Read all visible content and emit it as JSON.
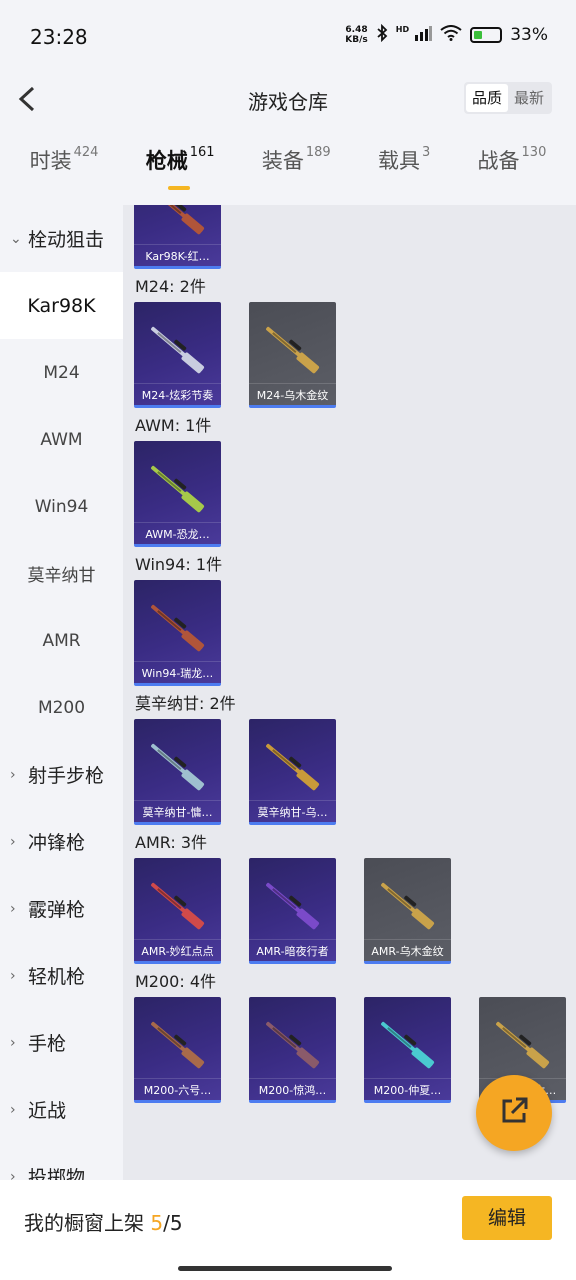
{
  "status_bar": {
    "time": "23:28",
    "net_speed_value": "6.48",
    "net_speed_unit": "KB/s",
    "signal_label": "HD",
    "battery_percent": "33%",
    "battery_level": 0.33,
    "icons": [
      "bluetooth-icon",
      "signal-icon",
      "wifi-icon",
      "battery-icon"
    ]
  },
  "header": {
    "title": "游戏仓库",
    "back_icon": "chevron-left-icon",
    "sort_options": [
      "品质",
      "最新"
    ],
    "sort_selected": "品质"
  },
  "tabs": [
    {
      "label": "时装",
      "count": "424"
    },
    {
      "label": "枪械",
      "count": "161",
      "active": true
    },
    {
      "label": "装备",
      "count": "189"
    },
    {
      "label": "载具",
      "count": "3"
    },
    {
      "label": "战备",
      "count": "130"
    }
  ],
  "sidebar": {
    "items": [
      {
        "label": "栓动狙击",
        "type": "group",
        "expanded": true
      },
      {
        "label": "Kar98K",
        "type": "sub",
        "active": true
      },
      {
        "label": "M24",
        "type": "sub"
      },
      {
        "label": "AWM",
        "type": "sub"
      },
      {
        "label": "Win94",
        "type": "sub"
      },
      {
        "label": "莫辛纳甘",
        "type": "sub"
      },
      {
        "label": "AMR",
        "type": "sub"
      },
      {
        "label": "M200",
        "type": "sub"
      },
      {
        "label": "射手步枪",
        "type": "group"
      },
      {
        "label": "冲锋枪",
        "type": "group"
      },
      {
        "label": "霰弹枪",
        "type": "group"
      },
      {
        "label": "轻机枪",
        "type": "group"
      },
      {
        "label": "手枪",
        "type": "group"
      },
      {
        "label": "近战",
        "type": "group"
      },
      {
        "label": "投掷物",
        "type": "group"
      }
    ]
  },
  "content": {
    "top_card": {
      "name": "Kar98K-红…"
    },
    "sections": [
      {
        "title": "M24: 2件",
        "items": [
          {
            "name": "M24-炫彩节奏",
            "style": "purple",
            "gun_color": "#c9cde0"
          },
          {
            "name": "M24-乌木金纹",
            "style": "gray",
            "gun_color": "#caa24a"
          }
        ]
      },
      {
        "title": "AWM: 1件",
        "items": [
          {
            "name": "AWM-恐龙…",
            "style": "purple",
            "gun_color": "#a6c94a"
          }
        ]
      },
      {
        "title": "Win94: 1件",
        "items": [
          {
            "name": "Win94-瑞龙…",
            "style": "purple",
            "gun_color": "#b0553a"
          }
        ]
      },
      {
        "title": "莫辛纳甘: 2件",
        "items": [
          {
            "name": "莫辛纳甘-慵…",
            "style": "purple",
            "gun_color": "#9fc0cf"
          },
          {
            "name": "莫辛纳甘-乌…",
            "style": "purple",
            "gun_color": "#c99a3a"
          }
        ]
      },
      {
        "title": "AMR: 3件",
        "items": [
          {
            "name": "AMR-妙红点点",
            "style": "purple",
            "gun_color": "#d04a4a"
          },
          {
            "name": "AMR-暗夜行者",
            "style": "purple",
            "gun_color": "#7a4ac9"
          },
          {
            "name": "AMR-乌木金纹",
            "style": "gray",
            "gun_color": "#c9a24a"
          }
        ]
      },
      {
        "title": "M200: 4件",
        "items": [
          {
            "name": "M200-六号…",
            "style": "purple",
            "gun_color": "#a86a4a"
          },
          {
            "name": "M200-惊鸿…",
            "style": "purple",
            "gun_color": "#8a5a6a"
          },
          {
            "name": "M200-仲夏…",
            "style": "purple",
            "gun_color": "#4ac9d0"
          },
          {
            "name": "M200-乌木…",
            "style": "gray",
            "gun_color": "#c9a24a"
          }
        ]
      }
    ]
  },
  "fab": {
    "icon": "share-external-icon"
  },
  "bottom_bar": {
    "shelf_label": "我的橱窗上架",
    "shelf_current": "5",
    "shelf_total": "/5",
    "edit_label": "编辑"
  }
}
